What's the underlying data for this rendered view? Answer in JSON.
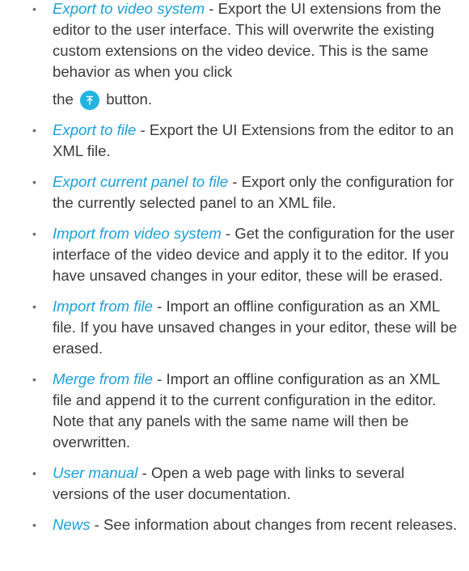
{
  "items": [
    {
      "term": "Export to video system",
      "desc": " - Export the UI extensions from the editor to the user interface. This will overwrite the existing custom extensions on the video device. This is the same behavior as when you click",
      "desc_before_icon": "the",
      "desc_after_icon": "button.",
      "icon": "export-upload-icon"
    },
    {
      "term": "Export to file",
      "desc": " - Export the UI Extensions from the editor to an XML file."
    },
    {
      "term": "Export current panel to file",
      "desc": " - Export only the configuration for the currently selected panel to an XML file."
    },
    {
      "term": "Import from video system",
      "desc": " - Get the configuration for the user interface of the video device and apply it to the editor. If you have unsaved changes in your editor, these will be erased."
    },
    {
      "term": "Import from file",
      "desc": " - Import an offline configuration as an XML file. If you have unsaved changes in your editor, these will be erased."
    },
    {
      "term": "Merge from file",
      "desc": " - Import an offline configuration as an XML file and append it to the current configuration in the editor. Note that any panels with the same name will then be overwritten."
    },
    {
      "term": "User manual",
      "desc": " - Open a web page with links to several versions of the user documentation."
    },
    {
      "term": "News",
      "desc": " - See information about changes from recent releases."
    }
  ],
  "bullet": "•",
  "colors": {
    "term": "#1ba0d7",
    "text": "#3a3a3a",
    "icon_bg": "#1fb4e2"
  }
}
